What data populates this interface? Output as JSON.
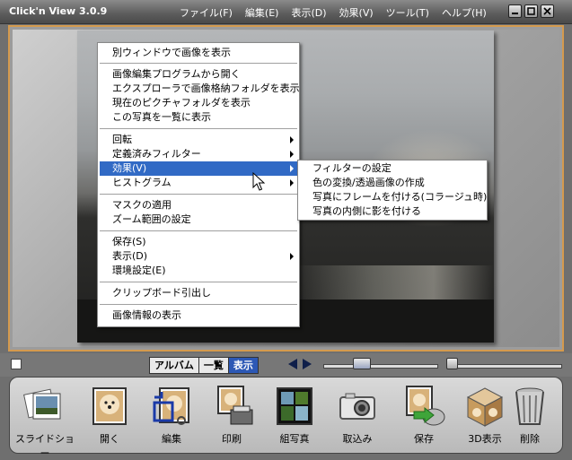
{
  "app": {
    "title": "Click'n View 3.0.9"
  },
  "menu": [
    "ファイル(F)",
    "編集(E)",
    "表示(D)",
    "効果(V)",
    "ツール(T)",
    "ヘルプ(H)"
  ],
  "context_menu": {
    "items": [
      {
        "label": "別ウィンドウで画像を表示"
      },
      {
        "label": "画像編集プログラムから開く"
      },
      {
        "label": "エクスプローラで画像格納フォルダを表示"
      },
      {
        "label": "現在のピクチャフォルダを表示"
      },
      {
        "label": "この写真を一覧に表示"
      },
      {
        "label": "回転"
      },
      {
        "label": "定義済みフィルター"
      },
      {
        "label": "効果(V)"
      },
      {
        "label": "ヒストグラム"
      },
      {
        "label": "マスクの適用"
      },
      {
        "label": "ズーム範囲の設定"
      },
      {
        "label": "保存(S)"
      },
      {
        "label": "表示(D)"
      },
      {
        "label": "環境設定(E)"
      },
      {
        "label": "クリップボード引出し"
      },
      {
        "label": "画像情報の表示"
      }
    ]
  },
  "submenu": {
    "items": [
      {
        "label": "フィルターの設定"
      },
      {
        "label": "色の変換/透過画像の作成"
      },
      {
        "label": "写真にフレームを付ける(コラージュ時)"
      },
      {
        "label": "写真の内側に影を付ける"
      }
    ]
  },
  "view_tabs": {
    "album": "アルバム",
    "list": "一覧",
    "show": "表示"
  },
  "toolbar": {
    "items": [
      {
        "label": "スライドショー",
        "icon": "slideshow-icon"
      },
      {
        "label": "開く",
        "icon": "open-icon"
      },
      {
        "label": "編集",
        "icon": "edit-icon"
      },
      {
        "label": "印刷",
        "icon": "print-icon"
      },
      {
        "label": "組写真",
        "icon": "photo-set-icon"
      },
      {
        "label": "取込み",
        "icon": "camera-icon"
      },
      {
        "label": "保存",
        "icon": "save-icon"
      },
      {
        "label": "3D表示",
        "icon": "3d-cube-icon"
      },
      {
        "label": "削除",
        "icon": "trash-icon"
      }
    ]
  },
  "colors": {
    "frame_border": "#d49a4e",
    "highlight": "#316ac5",
    "active_tab": "#2c58b5"
  }
}
